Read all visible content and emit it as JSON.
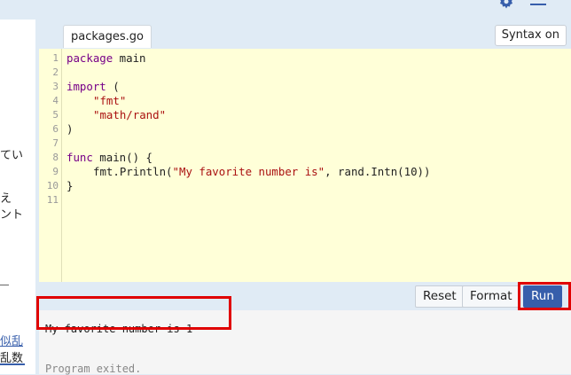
{
  "icons": {
    "settings": "gear-icon",
    "menu": "hamburger-menu-icon"
  },
  "sidebar": {
    "fragments": [
      "てい",
      "え",
      "ント",
      "-",
      "似乱",
      "乱数"
    ],
    "link_text": "似乱"
  },
  "editor": {
    "file_tab": "packages.go",
    "syntax_toggle": "Syntax on",
    "line_numbers": [
      "1",
      "2",
      "3",
      "4",
      "5",
      "6",
      "7",
      "8",
      "9",
      "10",
      "11"
    ],
    "code": {
      "l1_kw": "package",
      "l1_rest": " main",
      "l3_kw": "import",
      "l3_rest": " (",
      "l4": "\"fmt\"",
      "l5": "\"math/rand\"",
      "l6": ")",
      "l8_kw": "func",
      "l8_rest": " main() {",
      "l9_a": "fmt.Println(",
      "l9_str": "\"My favorite number is\"",
      "l9_b": ", rand.Intn(10))",
      "l10": "}"
    }
  },
  "toolbar": {
    "reset": "Reset",
    "format": "Format",
    "run": "Run"
  },
  "output": {
    "line1": "My favorite number is 1",
    "exit": "Program exited."
  },
  "colors": {
    "accent": "#375eab",
    "editor_bg": "#ffffd8",
    "highlight": "#e00000"
  }
}
